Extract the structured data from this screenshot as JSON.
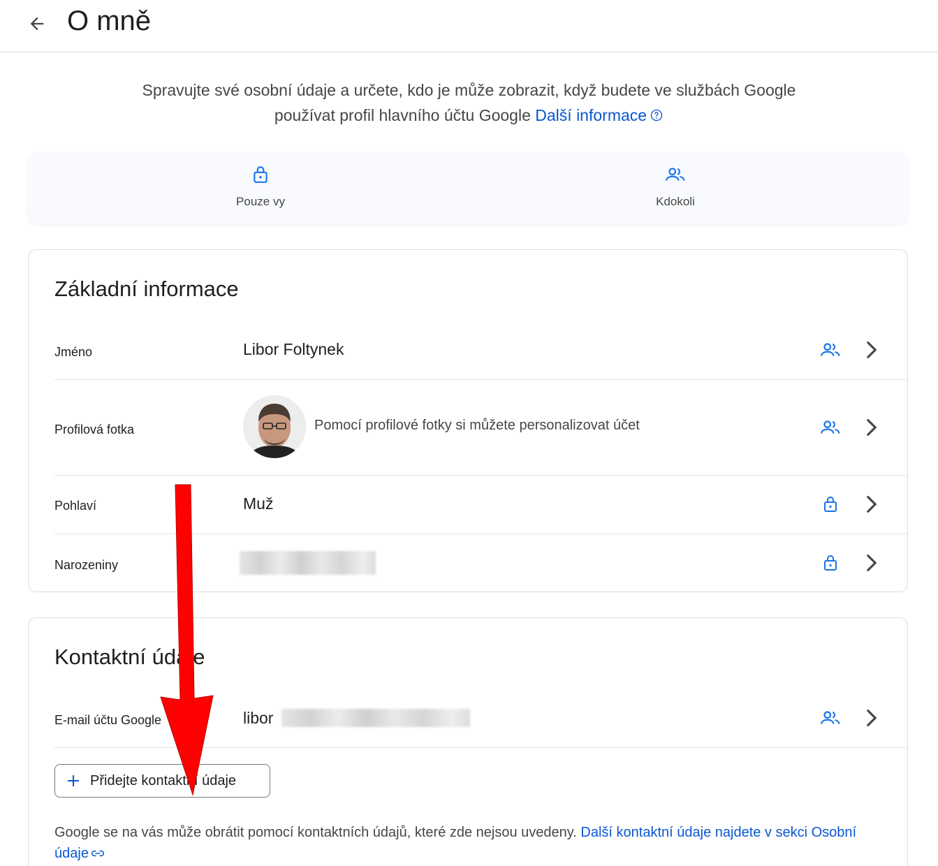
{
  "header": {
    "title": "O mně",
    "back_icon": "arrow-back-icon"
  },
  "intro": {
    "text": "Spravujte své osobní údaje a určete, kdo je může zobrazit, když budete ve službách Google používat profil hlavního účtu Google",
    "link": "Další informace",
    "help_icon": "help-icon"
  },
  "legend": {
    "only_you": {
      "label": "Pouze vy",
      "icon": "lock-icon"
    },
    "anyone": {
      "label": "Kdokoli",
      "icon": "people-icon"
    }
  },
  "basic_info": {
    "title": "Základní informace",
    "rows": [
      {
        "label": "Jméno",
        "value": "Libor Foltynek",
        "visibility": "people-icon"
      },
      {
        "label": "Profilová fotka",
        "value": "Pomocí profilové fotky si můžete personalizovat účet",
        "visibility": "people-icon"
      },
      {
        "label": "Pohlaví",
        "value": "Muž",
        "visibility": "lock-icon"
      },
      {
        "label": "Narozeniny",
        "value": "",
        "visibility": "lock-icon"
      }
    ]
  },
  "contact_info": {
    "title": "Kontaktní údaje",
    "email_label": "E-mail účtu Google",
    "email_value_visible": "libor",
    "email_visibility": "people-icon",
    "add_button": "Přidejte kontaktní údaje",
    "footnote_text": "Google se na vás může obrátit pomocí kontaktních údajů, které zde nejsou uvedeny.",
    "footnote_link": "Další kontaktní údaje najdete v sekci Osobní údaje"
  },
  "colors": {
    "accent": "#0b57d0",
    "icon_blue": "#1a73e8",
    "annotation_arrow": "#ff0000"
  }
}
